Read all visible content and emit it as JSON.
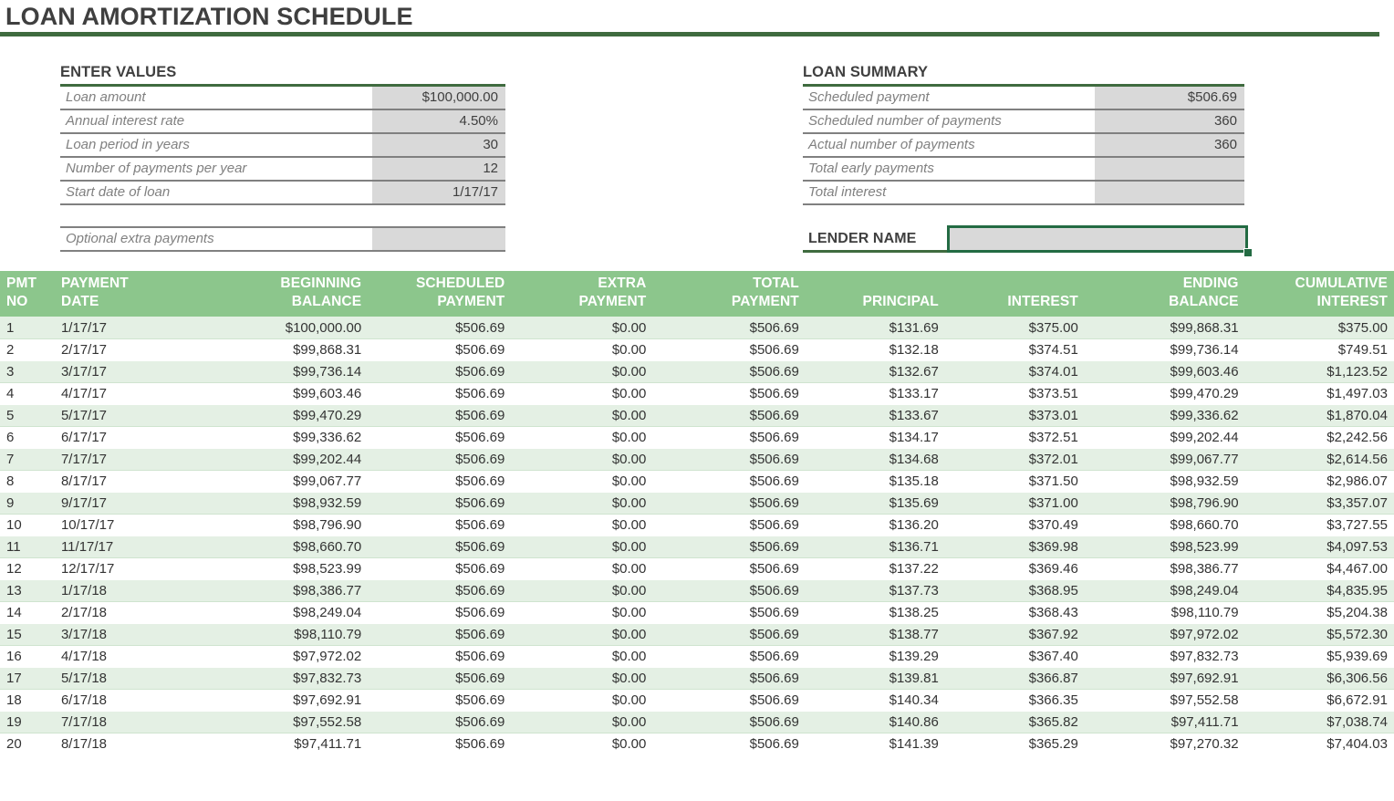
{
  "document": {
    "title": "LOAN AMORTIZATION SCHEDULE",
    "accent_color": "#3f6b3f",
    "header_fill": "#8cc68c",
    "band_fill": "#e4f0e4",
    "input_fill": "#d9d9d9",
    "selection_color": "#236b43"
  },
  "enter_values": {
    "heading": "ENTER VALUES",
    "rows": [
      {
        "label": "Loan amount",
        "value": "$100,000.00"
      },
      {
        "label": "Annual interest rate",
        "value": "4.50%"
      },
      {
        "label": "Loan period in years",
        "value": "30"
      },
      {
        "label": "Number of payments per year",
        "value": "12"
      },
      {
        "label": "Start date of loan",
        "value": "1/17/17"
      }
    ],
    "extra_payments": {
      "label": "Optional extra payments",
      "value": ""
    }
  },
  "loan_summary": {
    "heading": "LOAN SUMMARY",
    "rows": [
      {
        "label": "Scheduled payment",
        "value": "$506.69"
      },
      {
        "label": "Scheduled number of payments",
        "value": "360"
      },
      {
        "label": "Actual number of payments",
        "value": "360"
      },
      {
        "label": "Total early payments",
        "value": ""
      },
      {
        "label": "Total interest",
        "value": ""
      }
    ]
  },
  "lender": {
    "label": "LENDER NAME",
    "value": "",
    "placeholder": ""
  },
  "schedule": {
    "columns": [
      {
        "line1": "PMT",
        "line2": "NO",
        "align": "num",
        "width": "w-pmtno"
      },
      {
        "line1": "PAYMENT",
        "line2": "DATE",
        "align": "txt",
        "width": "w-date"
      },
      {
        "line1": "BEGINNING",
        "line2": "BALANCE",
        "align": "val",
        "width": "w-begbal"
      },
      {
        "line1": "SCHEDULED",
        "line2": "PAYMENT",
        "align": "val",
        "width": "w-sched"
      },
      {
        "line1": "EXTRA",
        "line2": "PAYMENT",
        "align": "val",
        "width": "w-extra"
      },
      {
        "line1": "TOTAL",
        "line2": "PAYMENT",
        "align": "val",
        "width": "w-total"
      },
      {
        "line1": "",
        "line2": "PRINCIPAL",
        "align": "val",
        "width": "w-princ"
      },
      {
        "line1": "",
        "line2": "INTEREST",
        "align": "val",
        "width": "w-int"
      },
      {
        "line1": "ENDING",
        "line2": "BALANCE",
        "align": "val",
        "width": "w-endbal"
      },
      {
        "line1": "CUMULATIVE",
        "line2": "INTEREST",
        "align": "val",
        "width": "w-cumint"
      }
    ],
    "rows": [
      [
        "1",
        "1/17/17",
        "$100,000.00",
        "$506.69",
        "$0.00",
        "$506.69",
        "$131.69",
        "$375.00",
        "$99,868.31",
        "$375.00"
      ],
      [
        "2",
        "2/17/17",
        "$99,868.31",
        "$506.69",
        "$0.00",
        "$506.69",
        "$132.18",
        "$374.51",
        "$99,736.14",
        "$749.51"
      ],
      [
        "3",
        "3/17/17",
        "$99,736.14",
        "$506.69",
        "$0.00",
        "$506.69",
        "$132.67",
        "$374.01",
        "$99,603.46",
        "$1,123.52"
      ],
      [
        "4",
        "4/17/17",
        "$99,603.46",
        "$506.69",
        "$0.00",
        "$506.69",
        "$133.17",
        "$373.51",
        "$99,470.29",
        "$1,497.03"
      ],
      [
        "5",
        "5/17/17",
        "$99,470.29",
        "$506.69",
        "$0.00",
        "$506.69",
        "$133.67",
        "$373.01",
        "$99,336.62",
        "$1,870.04"
      ],
      [
        "6",
        "6/17/17",
        "$99,336.62",
        "$506.69",
        "$0.00",
        "$506.69",
        "$134.17",
        "$372.51",
        "$99,202.44",
        "$2,242.56"
      ],
      [
        "7",
        "7/17/17",
        "$99,202.44",
        "$506.69",
        "$0.00",
        "$506.69",
        "$134.68",
        "$372.01",
        "$99,067.77",
        "$2,614.56"
      ],
      [
        "8",
        "8/17/17",
        "$99,067.77",
        "$506.69",
        "$0.00",
        "$506.69",
        "$135.18",
        "$371.50",
        "$98,932.59",
        "$2,986.07"
      ],
      [
        "9",
        "9/17/17",
        "$98,932.59",
        "$506.69",
        "$0.00",
        "$506.69",
        "$135.69",
        "$371.00",
        "$98,796.90",
        "$3,357.07"
      ],
      [
        "10",
        "10/17/17",
        "$98,796.90",
        "$506.69",
        "$0.00",
        "$506.69",
        "$136.20",
        "$370.49",
        "$98,660.70",
        "$3,727.55"
      ],
      [
        "11",
        "11/17/17",
        "$98,660.70",
        "$506.69",
        "$0.00",
        "$506.69",
        "$136.71",
        "$369.98",
        "$98,523.99",
        "$4,097.53"
      ],
      [
        "12",
        "12/17/17",
        "$98,523.99",
        "$506.69",
        "$0.00",
        "$506.69",
        "$137.22",
        "$369.46",
        "$98,386.77",
        "$4,467.00"
      ],
      [
        "13",
        "1/17/18",
        "$98,386.77",
        "$506.69",
        "$0.00",
        "$506.69",
        "$137.73",
        "$368.95",
        "$98,249.04",
        "$4,835.95"
      ],
      [
        "14",
        "2/17/18",
        "$98,249.04",
        "$506.69",
        "$0.00",
        "$506.69",
        "$138.25",
        "$368.43",
        "$98,110.79",
        "$5,204.38"
      ],
      [
        "15",
        "3/17/18",
        "$98,110.79",
        "$506.69",
        "$0.00",
        "$506.69",
        "$138.77",
        "$367.92",
        "$97,972.02",
        "$5,572.30"
      ],
      [
        "16",
        "4/17/18",
        "$97,972.02",
        "$506.69",
        "$0.00",
        "$506.69",
        "$139.29",
        "$367.40",
        "$97,832.73",
        "$5,939.69"
      ],
      [
        "17",
        "5/17/18",
        "$97,832.73",
        "$506.69",
        "$0.00",
        "$506.69",
        "$139.81",
        "$366.87",
        "$97,692.91",
        "$6,306.56"
      ],
      [
        "18",
        "6/17/18",
        "$97,692.91",
        "$506.69",
        "$0.00",
        "$506.69",
        "$140.34",
        "$366.35",
        "$97,552.58",
        "$6,672.91"
      ],
      [
        "19",
        "7/17/18",
        "$97,552.58",
        "$506.69",
        "$0.00",
        "$506.69",
        "$140.86",
        "$365.82",
        "$97,411.71",
        "$7,038.74"
      ],
      [
        "20",
        "8/17/18",
        "$97,411.71",
        "$506.69",
        "$0.00",
        "$506.69",
        "$141.39",
        "$365.29",
        "$97,270.32",
        "$7,404.03"
      ]
    ]
  }
}
